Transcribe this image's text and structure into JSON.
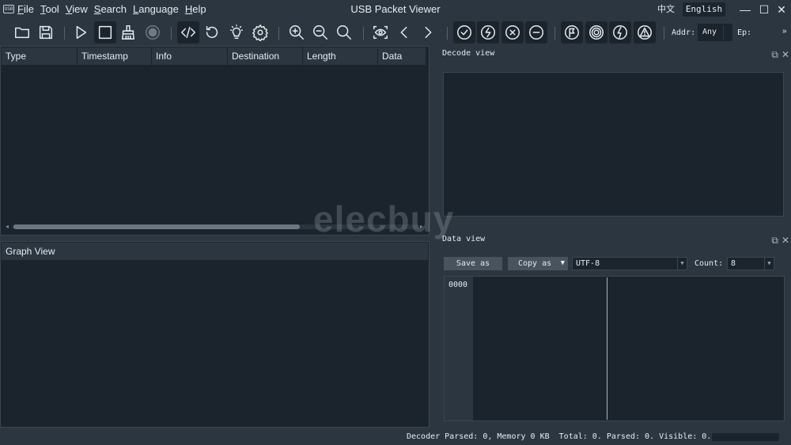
{
  "app": {
    "icon_text": "USB",
    "title": "USB Packet Viewer",
    "menu": [
      "File",
      "Tool",
      "View",
      "Search",
      "Language",
      "Help"
    ],
    "lang_cn": "中文",
    "lang_en": "English",
    "window_buttons": {
      "minimize": "—",
      "maximize": "☐",
      "close": "✕"
    }
  },
  "toolbar": {
    "addr_label": "Addr:",
    "addr_value": "Any",
    "ep_label": "Ep:",
    "more": "»"
  },
  "packet_table": {
    "columns": [
      "Type",
      "Timestamp",
      "Info",
      "Destination",
      "Length",
      "Data"
    ]
  },
  "graph_view": {
    "title": "Graph View"
  },
  "decode_view": {
    "title": "Decode view"
  },
  "data_view": {
    "title": "Data view",
    "save_as": "Save as",
    "copy_as": "Copy as",
    "encoding": "UTF-8",
    "count_label": "Count:",
    "count_value": "8",
    "offset_first": "0000"
  },
  "status": {
    "text": "Decoder Parsed: 0, Memory 0 KB  Total: 0. Parsed: 0. Visible: 0."
  },
  "watermark": "elecbuy"
}
